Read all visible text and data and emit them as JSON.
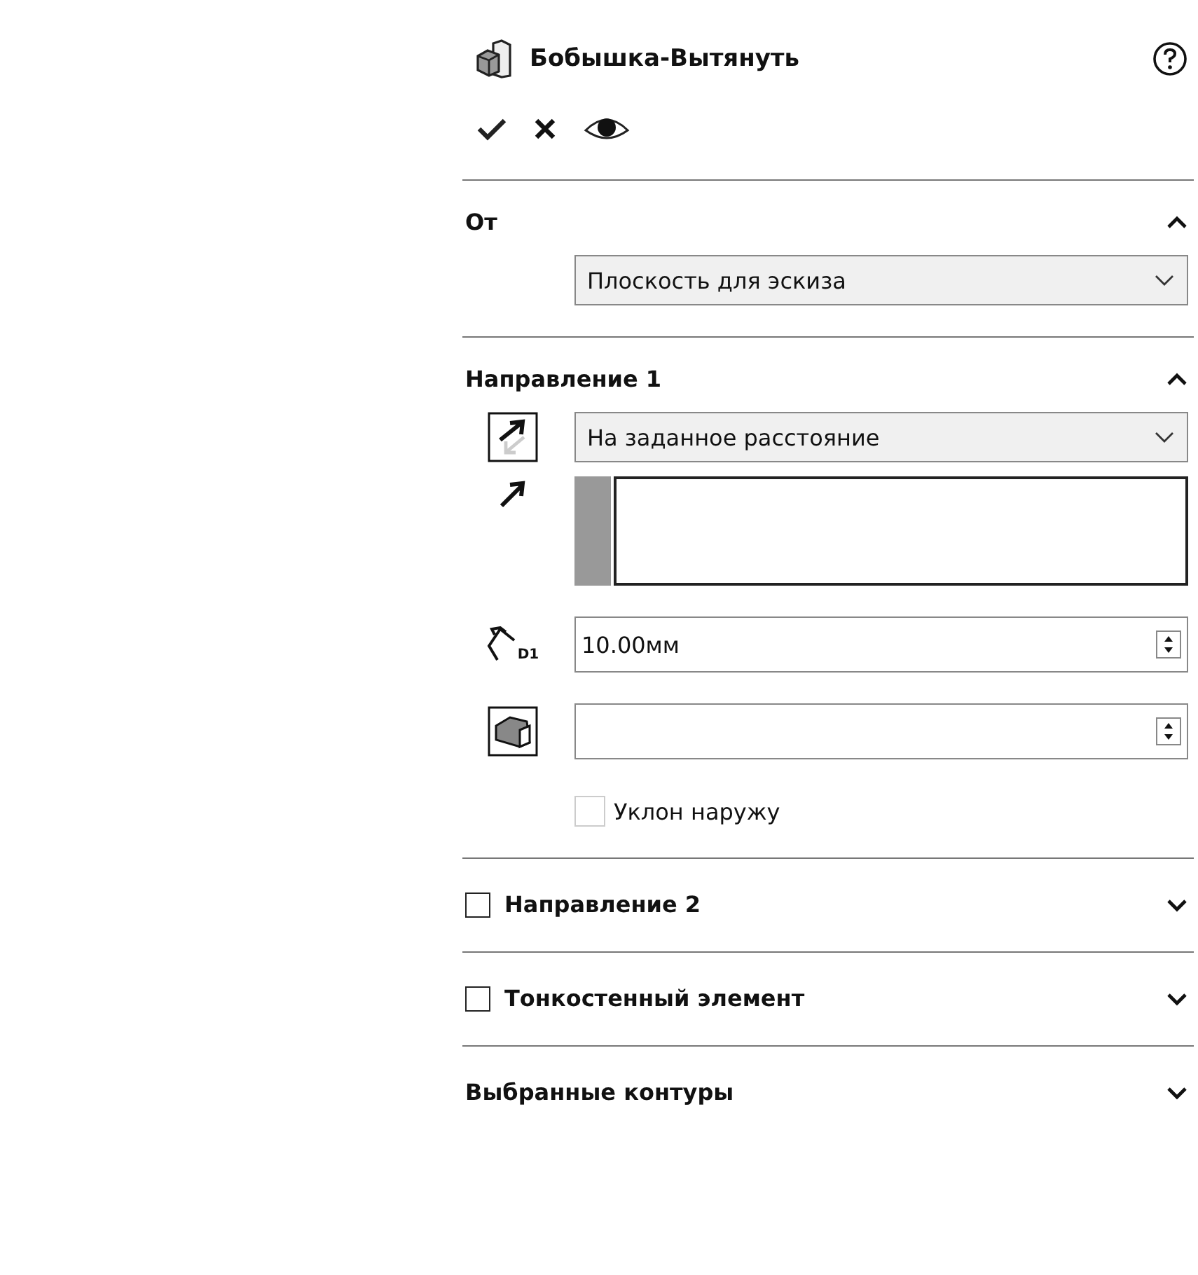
{
  "header": {
    "title": "Бобышка-Вытянуть"
  },
  "actions": [
    {
      "kind": "ok"
    },
    {
      "kind": "cancel"
    },
    {
      "kind": "preview"
    }
  ],
  "sections": [
    {
      "kind": "from",
      "title": "От",
      "expanded": true,
      "start": {
        "value": "Плоскость для эскиза"
      }
    },
    {
      "kind": "direction",
      "title": "Направление 1",
      "expanded": true,
      "end_condition": {
        "value": "На заданное расстояние"
      },
      "depth": {
        "icon_label": "D1",
        "value": "10.00мм"
      },
      "draft_outward": {
        "label": "Уклон наружу",
        "checked": false,
        "disabled": true
      }
    },
    {
      "kind": "option",
      "title": "Направление 2",
      "checked": false,
      "expanded": false
    },
    {
      "kind": "option",
      "title": "Тонкостенный элемент",
      "checked": false,
      "expanded": false
    },
    {
      "kind": "plain",
      "title": "Выбранные контуры",
      "expanded": false
    }
  ]
}
